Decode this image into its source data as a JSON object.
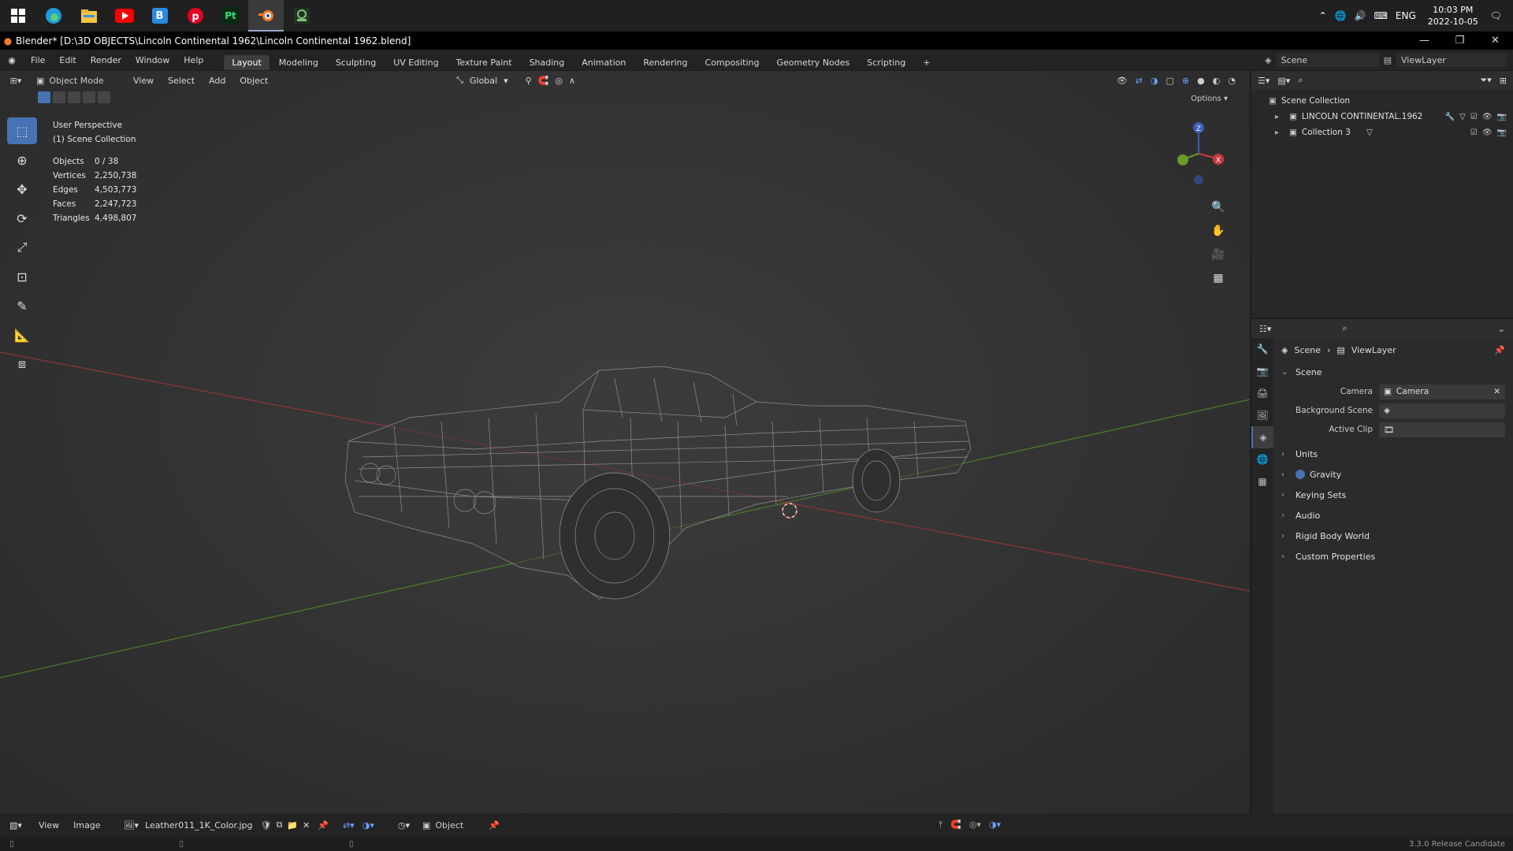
{
  "taskbar": {
    "icons": [
      "windows-start-icon",
      "edge-icon",
      "file-explorer-icon",
      "youtube-icon",
      "bluestacks-icon",
      "pinterest-icon",
      "pt-app-icon",
      "blender-icon",
      "app-icon"
    ],
    "pt_label": "Pt",
    "bluestacks_label": "B",
    "lang": "ENG",
    "time": "10:03 PM",
    "date": "2022-10-05"
  },
  "window": {
    "title": "Blender* [D:\\3D OBJECTS\\Lincoln Continental 1962\\Lincoln Continental 1962.blend]"
  },
  "menu": [
    "File",
    "Edit",
    "Render",
    "Window",
    "Help"
  ],
  "workspaces": [
    "Layout",
    "Modeling",
    "Sculpting",
    "UV Editing",
    "Texture Paint",
    "Shading",
    "Animation",
    "Rendering",
    "Compositing",
    "Geometry Nodes",
    "Scripting"
  ],
  "active_workspace": "Layout",
  "add_workspace": "+",
  "scene_field": "Scene",
  "viewlayer_field": "ViewLayer",
  "viewport": {
    "mode": "Object Mode",
    "menus": [
      "View",
      "Select",
      "Add",
      "Object"
    ],
    "orientation": "Global",
    "options": "Options",
    "perspective": "User Perspective",
    "collection": "(1) Scene Collection",
    "stats": [
      {
        "k": "Objects",
        "v": "0 / 38"
      },
      {
        "k": "Vertices",
        "v": "2,250,738"
      },
      {
        "k": "Edges",
        "v": "4,503,773"
      },
      {
        "k": "Faces",
        "v": "2,247,723"
      },
      {
        "k": "Triangles",
        "v": "4,498,807"
      }
    ],
    "gizmo": {
      "z": "Z",
      "x": "X"
    }
  },
  "outliner": {
    "root": "Scene Collection",
    "rows": [
      "LINCOLN CONTINENTAL.1962",
      "Collection 3"
    ]
  },
  "properties": {
    "breadcrumb_scene": "Scene",
    "breadcrumb_viewlayer": "ViewLayer",
    "panel": "Scene",
    "camera_label": "Camera",
    "camera_value": "Camera",
    "bg_scene_label": "Background Scene",
    "active_clip_label": "Active Clip",
    "sections": [
      "Units",
      "Gravity",
      "Keying Sets",
      "Audio",
      "Rigid Body World",
      "Custom Properties"
    ]
  },
  "bottom": {
    "menus": [
      "View",
      "Image"
    ],
    "image_name": "Leather011_1K_Color.jpg",
    "object_field": "Object"
  },
  "status": {
    "version": "3.3.0 Release Candidate"
  },
  "colors": {
    "accent": "#4772b3",
    "x_axis": "#c8393f",
    "y_axis": "#6a9a2c",
    "z_axis": "#3a5fb5"
  }
}
